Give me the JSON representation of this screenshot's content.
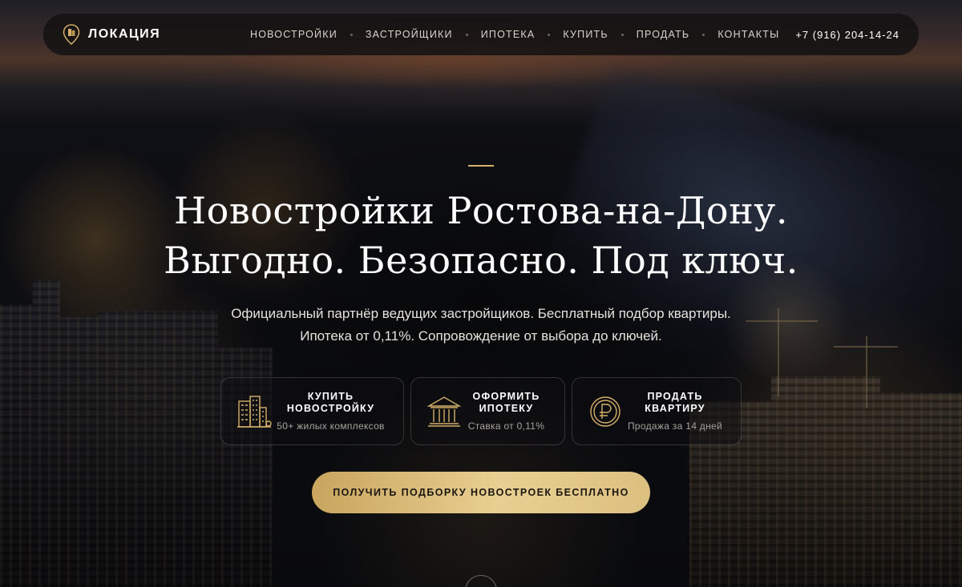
{
  "header": {
    "logo_text": "ЛОКАЦИЯ",
    "nav": [
      {
        "label": "НОВОСТРОЙКИ"
      },
      {
        "label": "ЗАСТРОЙЩИКИ"
      },
      {
        "label": "ИПОТЕКА"
      },
      {
        "label": "КУПИТЬ"
      },
      {
        "label": "ПРОДАТЬ"
      },
      {
        "label": "КОНТАКТЫ"
      }
    ],
    "phone": "+7 (916) 204-14-24"
  },
  "hero": {
    "title_line1": "Новостройки Ростова-на-Дону.",
    "title_line2": "Выгодно. Безопасно. Под ключ.",
    "subtitle_line1": "Официальный партнёр ведущих застройщиков. Бесплатный подбор квартиры.",
    "subtitle_line2": "Ипотека от 0,11%. Сопровождение от выбора до ключей."
  },
  "cards": [
    {
      "icon": "buildings-icon",
      "title_line1": "КУПИТЬ",
      "title_line2": "НОВОСТРОЙКУ",
      "note": "50+ жилых комплексов"
    },
    {
      "icon": "bank-icon",
      "title_line1": "ОФОРМИТЬ",
      "title_line2": "ИПОТЕКУ",
      "note": "Ставка от 0,11%"
    },
    {
      "icon": "ruble-coin-icon",
      "title_line1": "ПРОДАТЬ",
      "title_line2": "КВАРТИРУ",
      "note": "Продажа за 14 дней"
    }
  ],
  "cta": {
    "label": "ПОЛУЧИТЬ ПОДБОРКУ НОВОСТРОЕК БЕСПЛАТНО"
  },
  "colors": {
    "accent_gold": "#d4b06a",
    "header_bg": "#141212",
    "cta_gradient_start": "#c9a55e",
    "cta_gradient_end": "#e8cf91"
  }
}
